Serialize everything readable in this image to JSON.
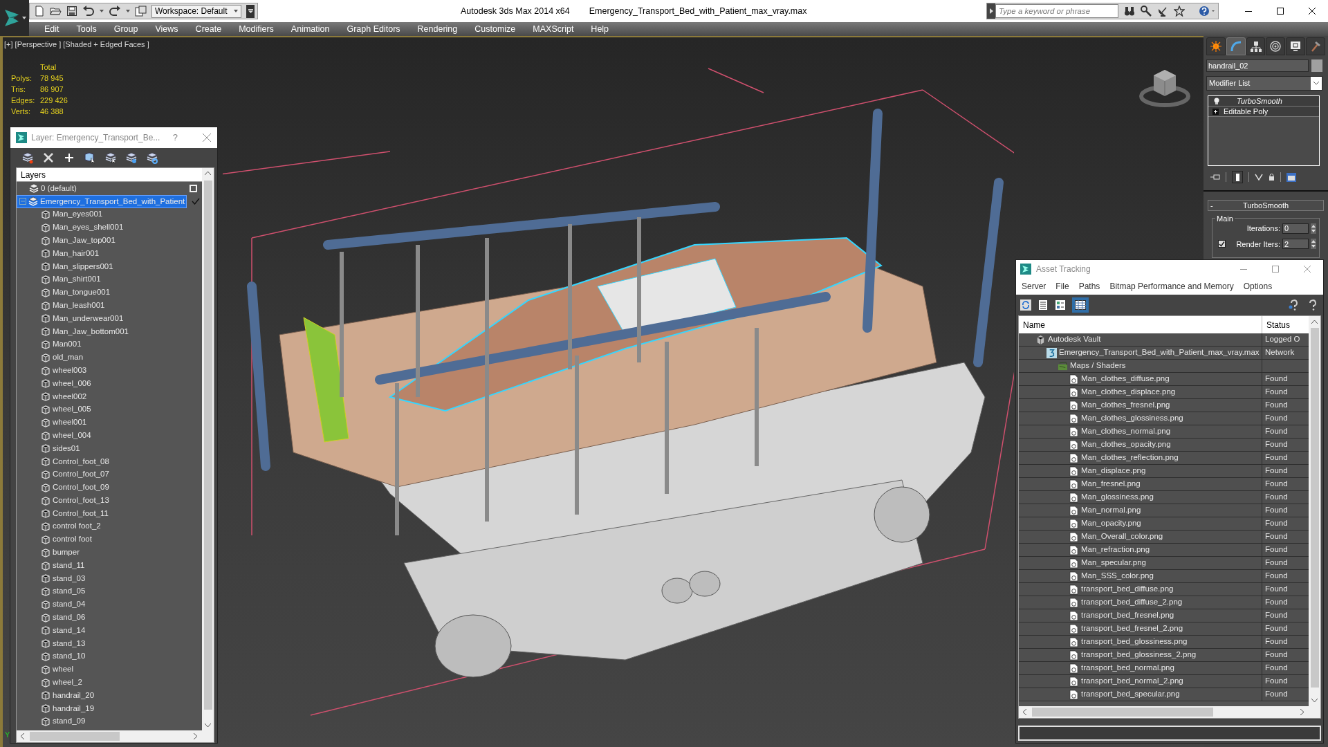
{
  "title_bar": {
    "workspace": "Workspace: Default",
    "app": "Autodesk 3ds Max  2014 x64",
    "file": "Emergency_Transport_Bed_with_Patient_max_vray.max",
    "search": {
      "placeholder": "Type a keyword or phrase"
    }
  },
  "menu": [
    "Edit",
    "Tools",
    "Group",
    "Views",
    "Create",
    "Modifiers",
    "Animation",
    "Graph Editors",
    "Rendering",
    "Customize",
    "MAXScript",
    "Help"
  ],
  "viewport": {
    "label": "[+] [Perspective ] [Shaded + Edged Faces ]",
    "axis_label": "Y",
    "stats": {
      "header": "Total",
      "rows": [
        {
          "label": "Polys:",
          "value": "78 945"
        },
        {
          "label": "Tris:",
          "value": "86 907"
        },
        {
          "label": "Edges:",
          "value": "229 426"
        },
        {
          "label": "Verts:",
          "value": "46 388"
        }
      ]
    }
  },
  "layer_dialog": {
    "title": "Layer: Emergency_Transport_Be...",
    "help": "?",
    "column": "Layers",
    "layers": [
      {
        "name": "0 (default)",
        "selected": false,
        "current": false
      },
      {
        "name": "Emergency_Transport_Bed_with_Patient",
        "selected": true,
        "current": true,
        "expanded": true,
        "children": [
          {
            "name": "Man_eyes001"
          },
          {
            "name": "Man_eyes_shell001"
          },
          {
            "name": "Man_Jaw_top001"
          },
          {
            "name": "Man_hair001"
          },
          {
            "name": "Man_slippers001"
          },
          {
            "name": "Man_shirt001"
          },
          {
            "name": "Man_tongue001"
          },
          {
            "name": "Man_leash001"
          },
          {
            "name": "Man_underwear001"
          },
          {
            "name": "Man_Jaw_bottom001"
          },
          {
            "name": "Man001"
          },
          {
            "name": "old_man"
          },
          {
            "name": "wheel003"
          },
          {
            "name": "wheel_006"
          },
          {
            "name": "wheel002"
          },
          {
            "name": "wheel_005"
          },
          {
            "name": "wheel001"
          },
          {
            "name": "wheel_004"
          },
          {
            "name": "sides01"
          },
          {
            "name": "Control_foot_08"
          },
          {
            "name": "Control_foot_07"
          },
          {
            "name": "Control_foot_09"
          },
          {
            "name": "Control_foot_13"
          },
          {
            "name": "Control_foot_11"
          },
          {
            "name": "control foot_2"
          },
          {
            "name": "control foot"
          },
          {
            "name": "bumper"
          },
          {
            "name": "stand_11"
          },
          {
            "name": "stand_03"
          },
          {
            "name": "stand_05"
          },
          {
            "name": "stand_04"
          },
          {
            "name": "stand_06"
          },
          {
            "name": "stand_14"
          },
          {
            "name": "stand_13"
          },
          {
            "name": "stand_10"
          },
          {
            "name": "wheel"
          },
          {
            "name": "wheel_2"
          },
          {
            "name": "handrail_20"
          },
          {
            "name": "handrail_19"
          },
          {
            "name": "stand_09"
          }
        ]
      }
    ]
  },
  "command_panel": {
    "tabs": [
      {
        "selected": false
      },
      {
        "selected": true
      },
      {
        "selected": false
      },
      {
        "selected": false
      },
      {
        "selected": false
      },
      {
        "selected": false
      }
    ],
    "object_name": "handrail_02",
    "modifier_list": "Modifier List",
    "stack": [
      {
        "name": "TurboSmooth",
        "kind": "modifier"
      },
      {
        "name": "Editable Poly",
        "kind": "base"
      }
    ],
    "rollout": {
      "toggle": "-",
      "title": "TurboSmooth",
      "group": "Main",
      "iterations": {
        "label": "Iterations:",
        "value": "0"
      },
      "render_iters": {
        "label": "Render Iters:",
        "value": "2",
        "checked": true
      }
    }
  },
  "asset_tracking": {
    "title": "Asset Tracking",
    "menu": [
      "Server",
      "File",
      "Paths",
      "Bitmap Performance and Memory",
      "Options"
    ],
    "columns": [
      "Name",
      "Status"
    ],
    "rows": [
      {
        "kind": "vault",
        "name": "Autodesk Vault",
        "status": "Logged O",
        "children": [
          {
            "kind": "scene",
            "name": "Emergency_Transport_Bed_with_Patient_max_vray.max",
            "status": "Network",
            "children": [
              {
                "kind": "folder",
                "name": "Maps / Shaders",
                "children": [
                  {
                    "kind": "map",
                    "name": "Man_clothes_diffuse.png",
                    "status": "Found"
                  },
                  {
                    "kind": "map",
                    "name": "Man_clothes_displace.png",
                    "status": "Found"
                  },
                  {
                    "kind": "map",
                    "name": "Man_clothes_fresnel.png",
                    "status": "Found"
                  },
                  {
                    "kind": "map",
                    "name": "Man_clothes_glossiness.png",
                    "status": "Found"
                  },
                  {
                    "kind": "map",
                    "name": "Man_clothes_normal.png",
                    "status": "Found"
                  },
                  {
                    "kind": "map",
                    "name": "Man_clothes_opacity.png",
                    "status": "Found"
                  },
                  {
                    "kind": "map",
                    "name": "Man_clothes_reflection.png",
                    "status": "Found"
                  },
                  {
                    "kind": "map",
                    "name": "Man_displace.png",
                    "status": "Found"
                  },
                  {
                    "kind": "map",
                    "name": "Man_fresnel.png",
                    "status": "Found"
                  },
                  {
                    "kind": "map",
                    "name": "Man_glossiness.png",
                    "status": "Found"
                  },
                  {
                    "kind": "map",
                    "name": "Man_normal.png",
                    "status": "Found"
                  },
                  {
                    "kind": "map",
                    "name": "Man_opacity.png",
                    "status": "Found"
                  },
                  {
                    "kind": "map",
                    "name": "Man_Overall_color.png",
                    "status": "Found"
                  },
                  {
                    "kind": "map",
                    "name": "Man_refraction.png",
                    "status": "Found"
                  },
                  {
                    "kind": "map",
                    "name": "Man_specular.png",
                    "status": "Found"
                  },
                  {
                    "kind": "map",
                    "name": "Man_SSS_color.png",
                    "status": "Found"
                  },
                  {
                    "kind": "map",
                    "name": "transport_bed_diffuse.png",
                    "status": "Found"
                  },
                  {
                    "kind": "map",
                    "name": "transport_bed_diffuse_2.png",
                    "status": "Found"
                  },
                  {
                    "kind": "map",
                    "name": "transport_bed_fresnel.png",
                    "status": "Found"
                  },
                  {
                    "kind": "map",
                    "name": "transport_bed_fresnel_2.png",
                    "status": "Found"
                  },
                  {
                    "kind": "map",
                    "name": "transport_bed_glossiness.png",
                    "status": "Found"
                  },
                  {
                    "kind": "map",
                    "name": "transport_bed_glossiness_2.png",
                    "status": "Found"
                  },
                  {
                    "kind": "map",
                    "name": "transport_bed_normal.png",
                    "status": "Found"
                  },
                  {
                    "kind": "map",
                    "name": "transport_bed_normal_2.png",
                    "status": "Found"
                  },
                  {
                    "kind": "map",
                    "name": "transport_bed_specular.png",
                    "status": "Found"
                  }
                ]
              }
            ]
          }
        ]
      }
    ]
  }
}
